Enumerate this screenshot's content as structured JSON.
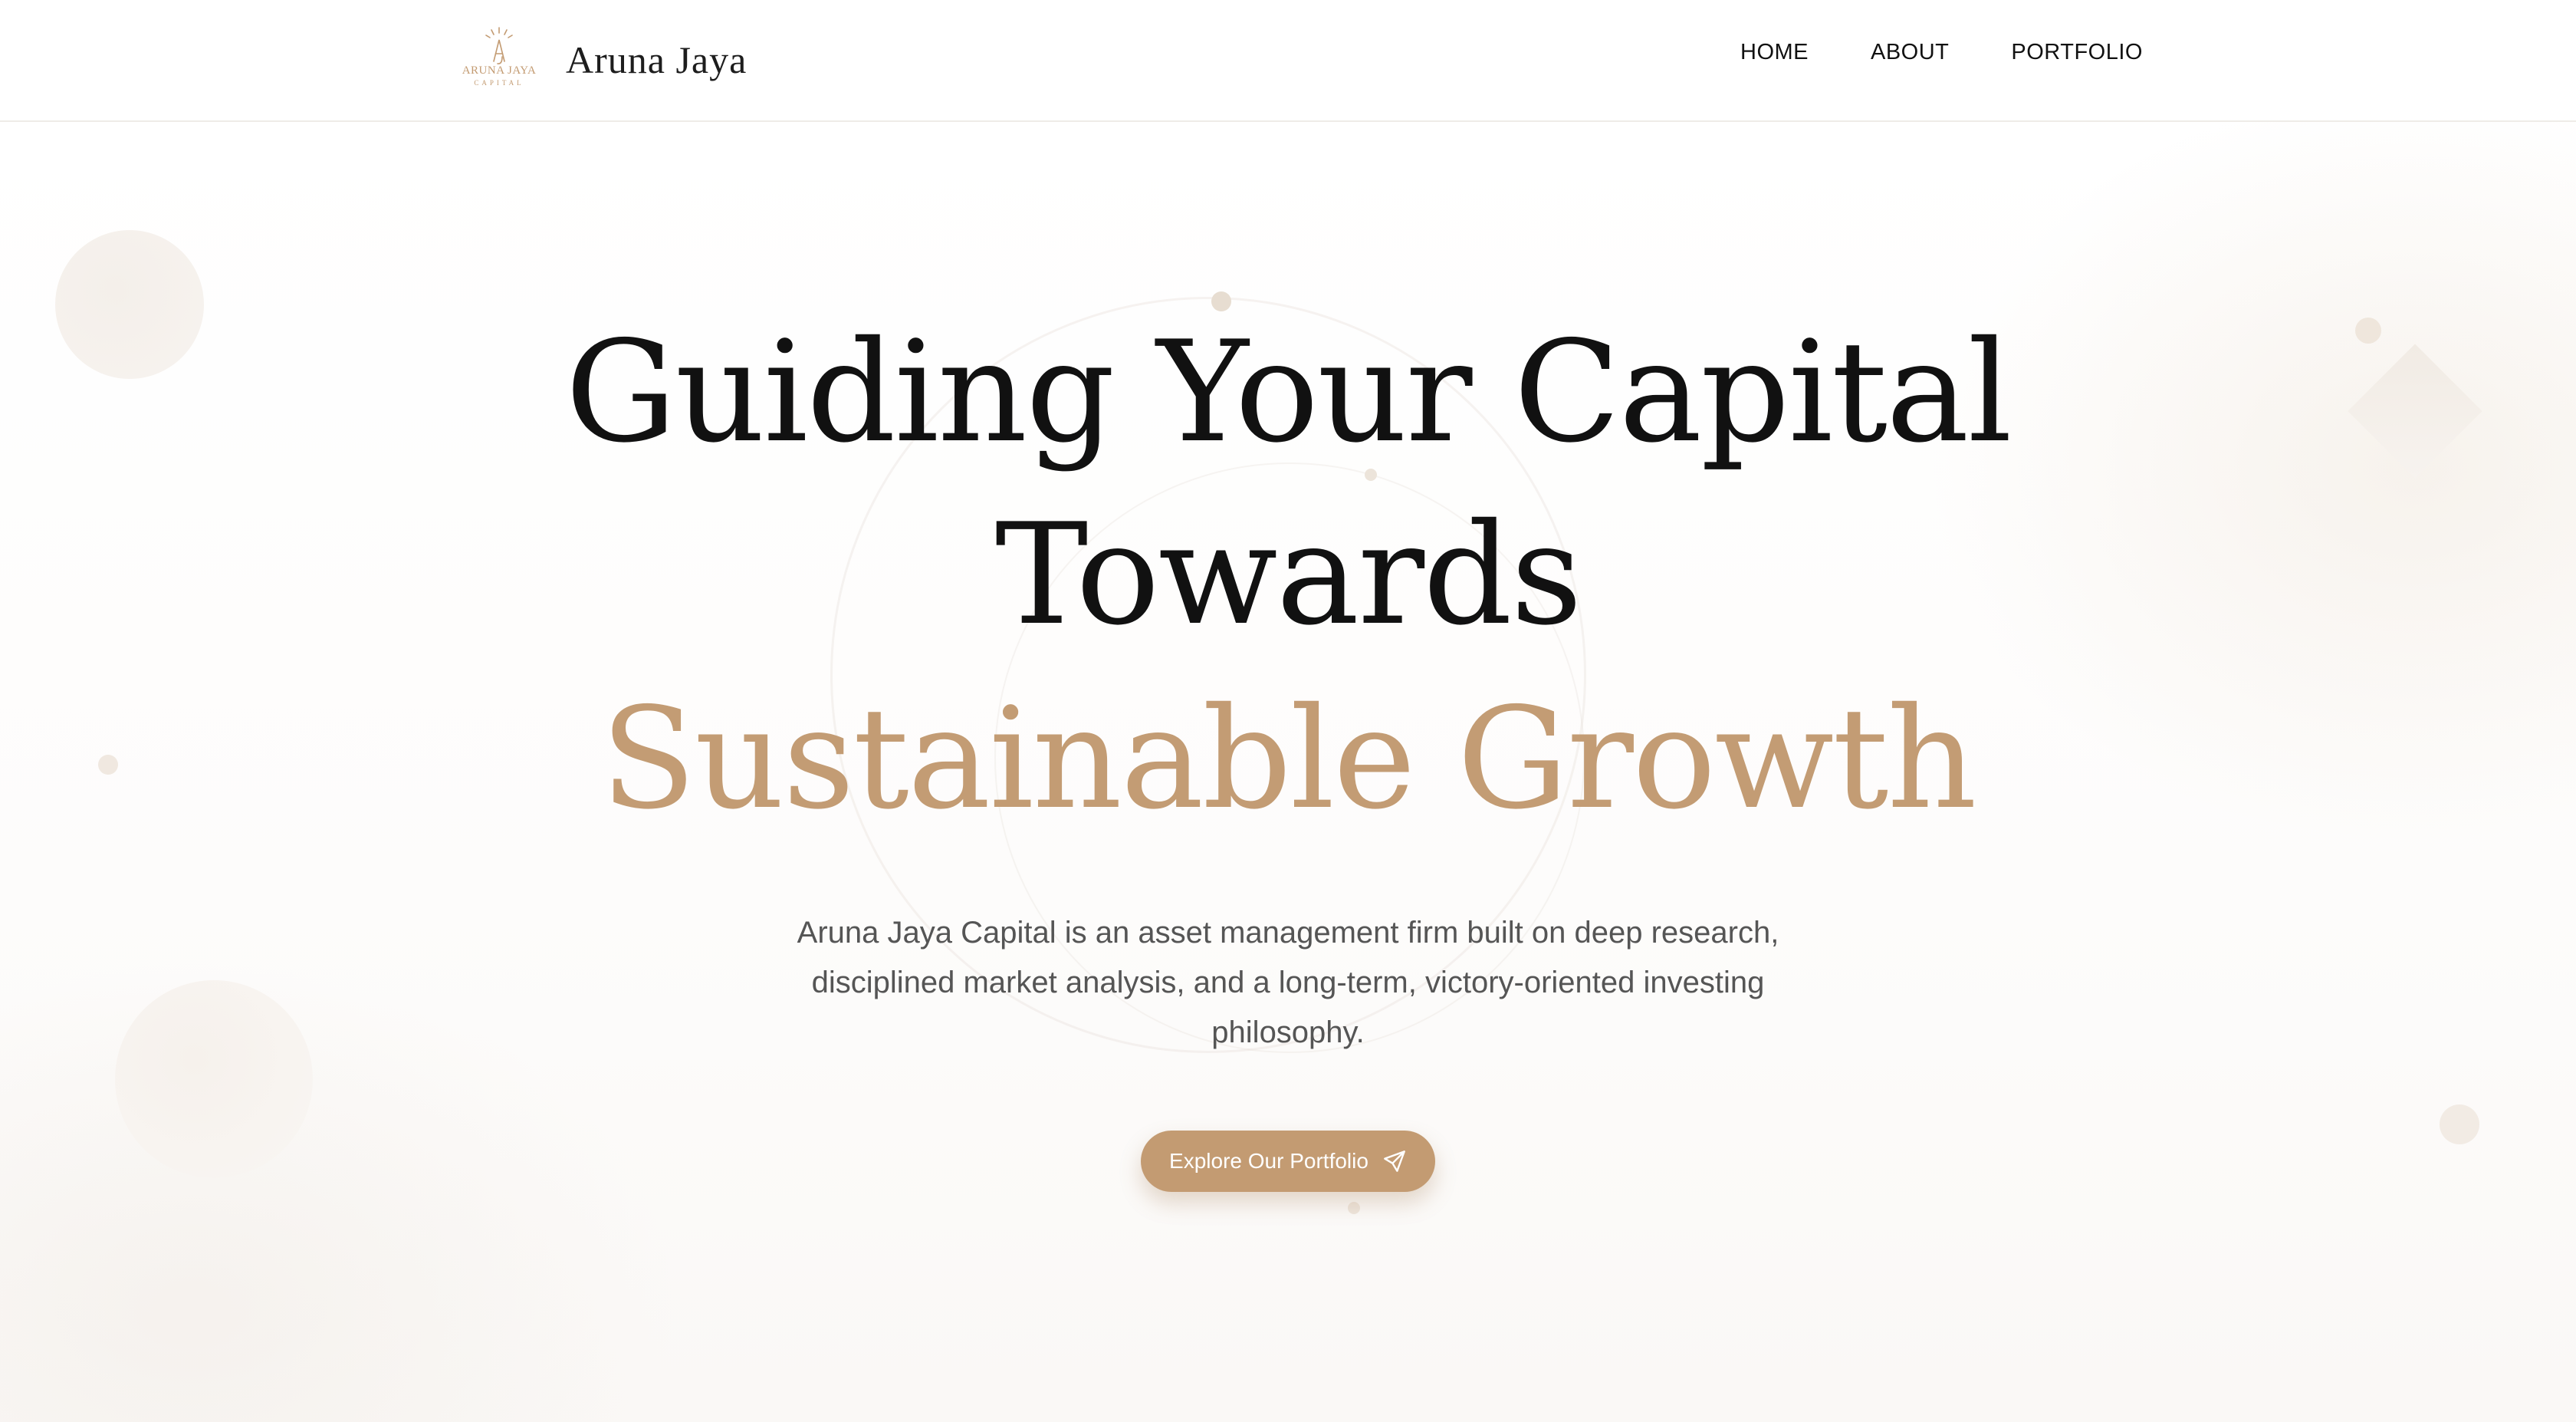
{
  "header": {
    "logo": {
      "wordmark_top": "ARUNA JAYA",
      "wordmark_bottom": "CAPITAL"
    },
    "brand_name": "Aruna Jaya",
    "nav": [
      {
        "label": "HOME"
      },
      {
        "label": "ABOUT"
      },
      {
        "label": "PORTFOLIO"
      }
    ]
  },
  "hero": {
    "headline_line1": "Guiding Your Capital",
    "headline_line2": "Towards",
    "headline_line3": "Sustainable Growth",
    "subtitle": "Aruna Jaya Capital is an asset management firm built on deep research, disciplined market analysis, and a long-term, victory-oriented investing philosophy.",
    "cta_label": "Explore Our Portfolio",
    "cta_icon": "paper-plane-icon"
  },
  "colors": {
    "accent": "#c39b72",
    "headline": "#111111",
    "body_text": "#555555",
    "background": "#ffffff"
  }
}
